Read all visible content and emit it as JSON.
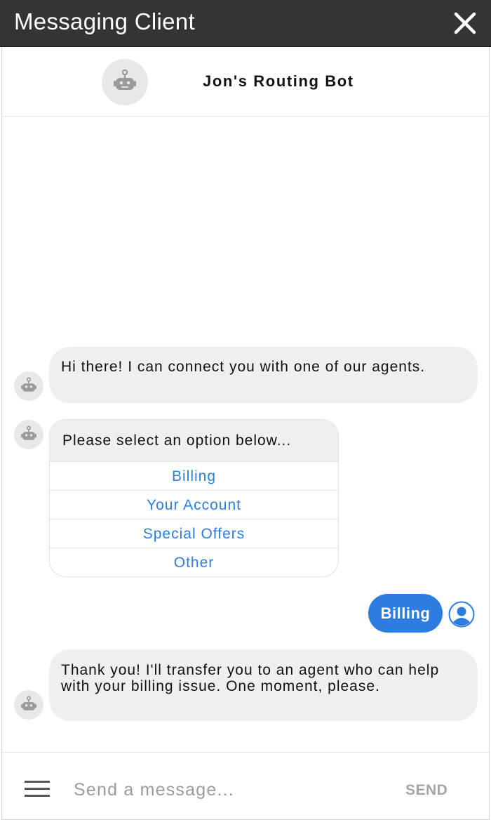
{
  "window": {
    "title": "Messaging Client",
    "close_icon": "close-icon"
  },
  "header": {
    "bot_name": "Jon's Routing Bot",
    "avatar_icon": "robot-icon"
  },
  "messages": [
    {
      "from": "bot",
      "text": "Hi there! I can connect you with one of our agents."
    },
    {
      "from": "bot",
      "type": "options",
      "prompt": "Please select an option below...",
      "options": [
        "Billing",
        "Your Account",
        "Special Offers",
        "Other"
      ]
    },
    {
      "from": "user",
      "text": "Billing"
    },
    {
      "from": "bot",
      "text": "Thank you! I'll transfer you to an agent who can help with your billing issue. One moment, please."
    }
  ],
  "composer": {
    "placeholder": "Send a message...",
    "send_label": "SEND",
    "menu_icon": "hamburger-menu-icon"
  },
  "colors": {
    "titlebar": "#333436",
    "accent": "#2d7de0",
    "bubble": "#efefef",
    "avatar_bg": "#e8e8e8",
    "robot": "#9a9a9a"
  }
}
